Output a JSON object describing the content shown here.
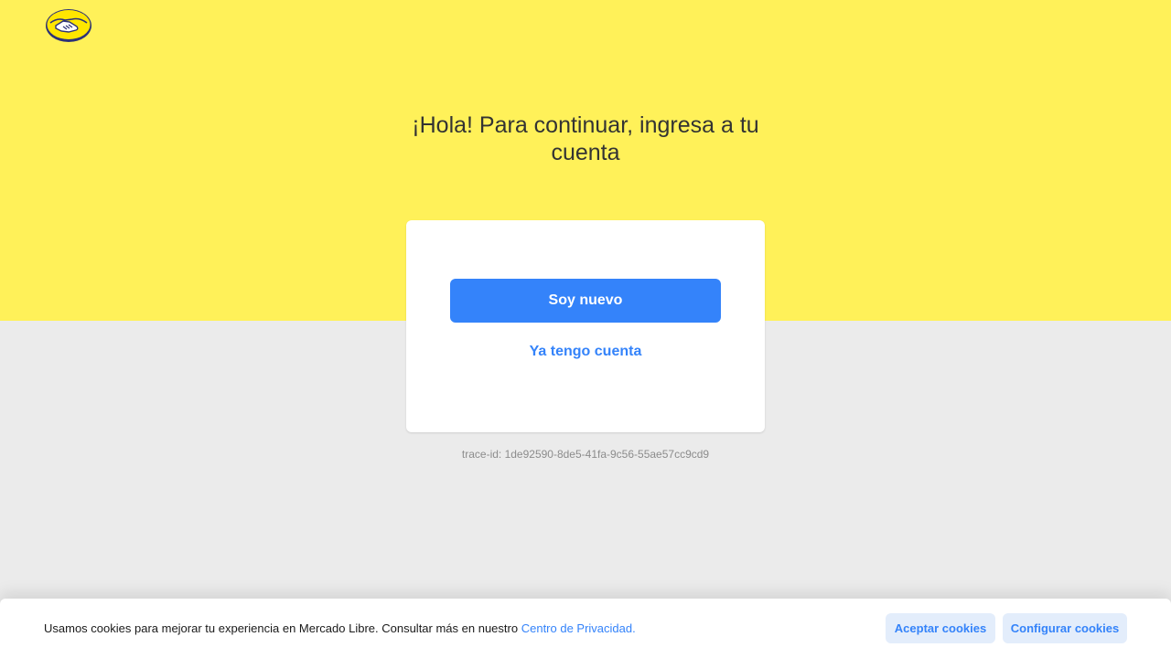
{
  "brand": {
    "logo_icon": "mercadolibre-handshake-icon",
    "band_color": "#fff159",
    "accent_color": "#3483fa"
  },
  "main": {
    "heading": "¡Hola! Para continuar, ingresa a tu cuenta",
    "primary_button": "Soy nuevo",
    "secondary_link": "Ya tengo cuenta",
    "trace_id": "trace-id: 1de92590-8de5-41fa-9c56-55ae57cc9cd9"
  },
  "cookies": {
    "message": "Usamos cookies para mejorar tu experiencia en Mercado Libre. Consultar más en nuestro",
    "privacy_link": "Centro de Privacidad.",
    "accept_button": "Aceptar cookies",
    "configure_button": "Configurar cookies"
  }
}
